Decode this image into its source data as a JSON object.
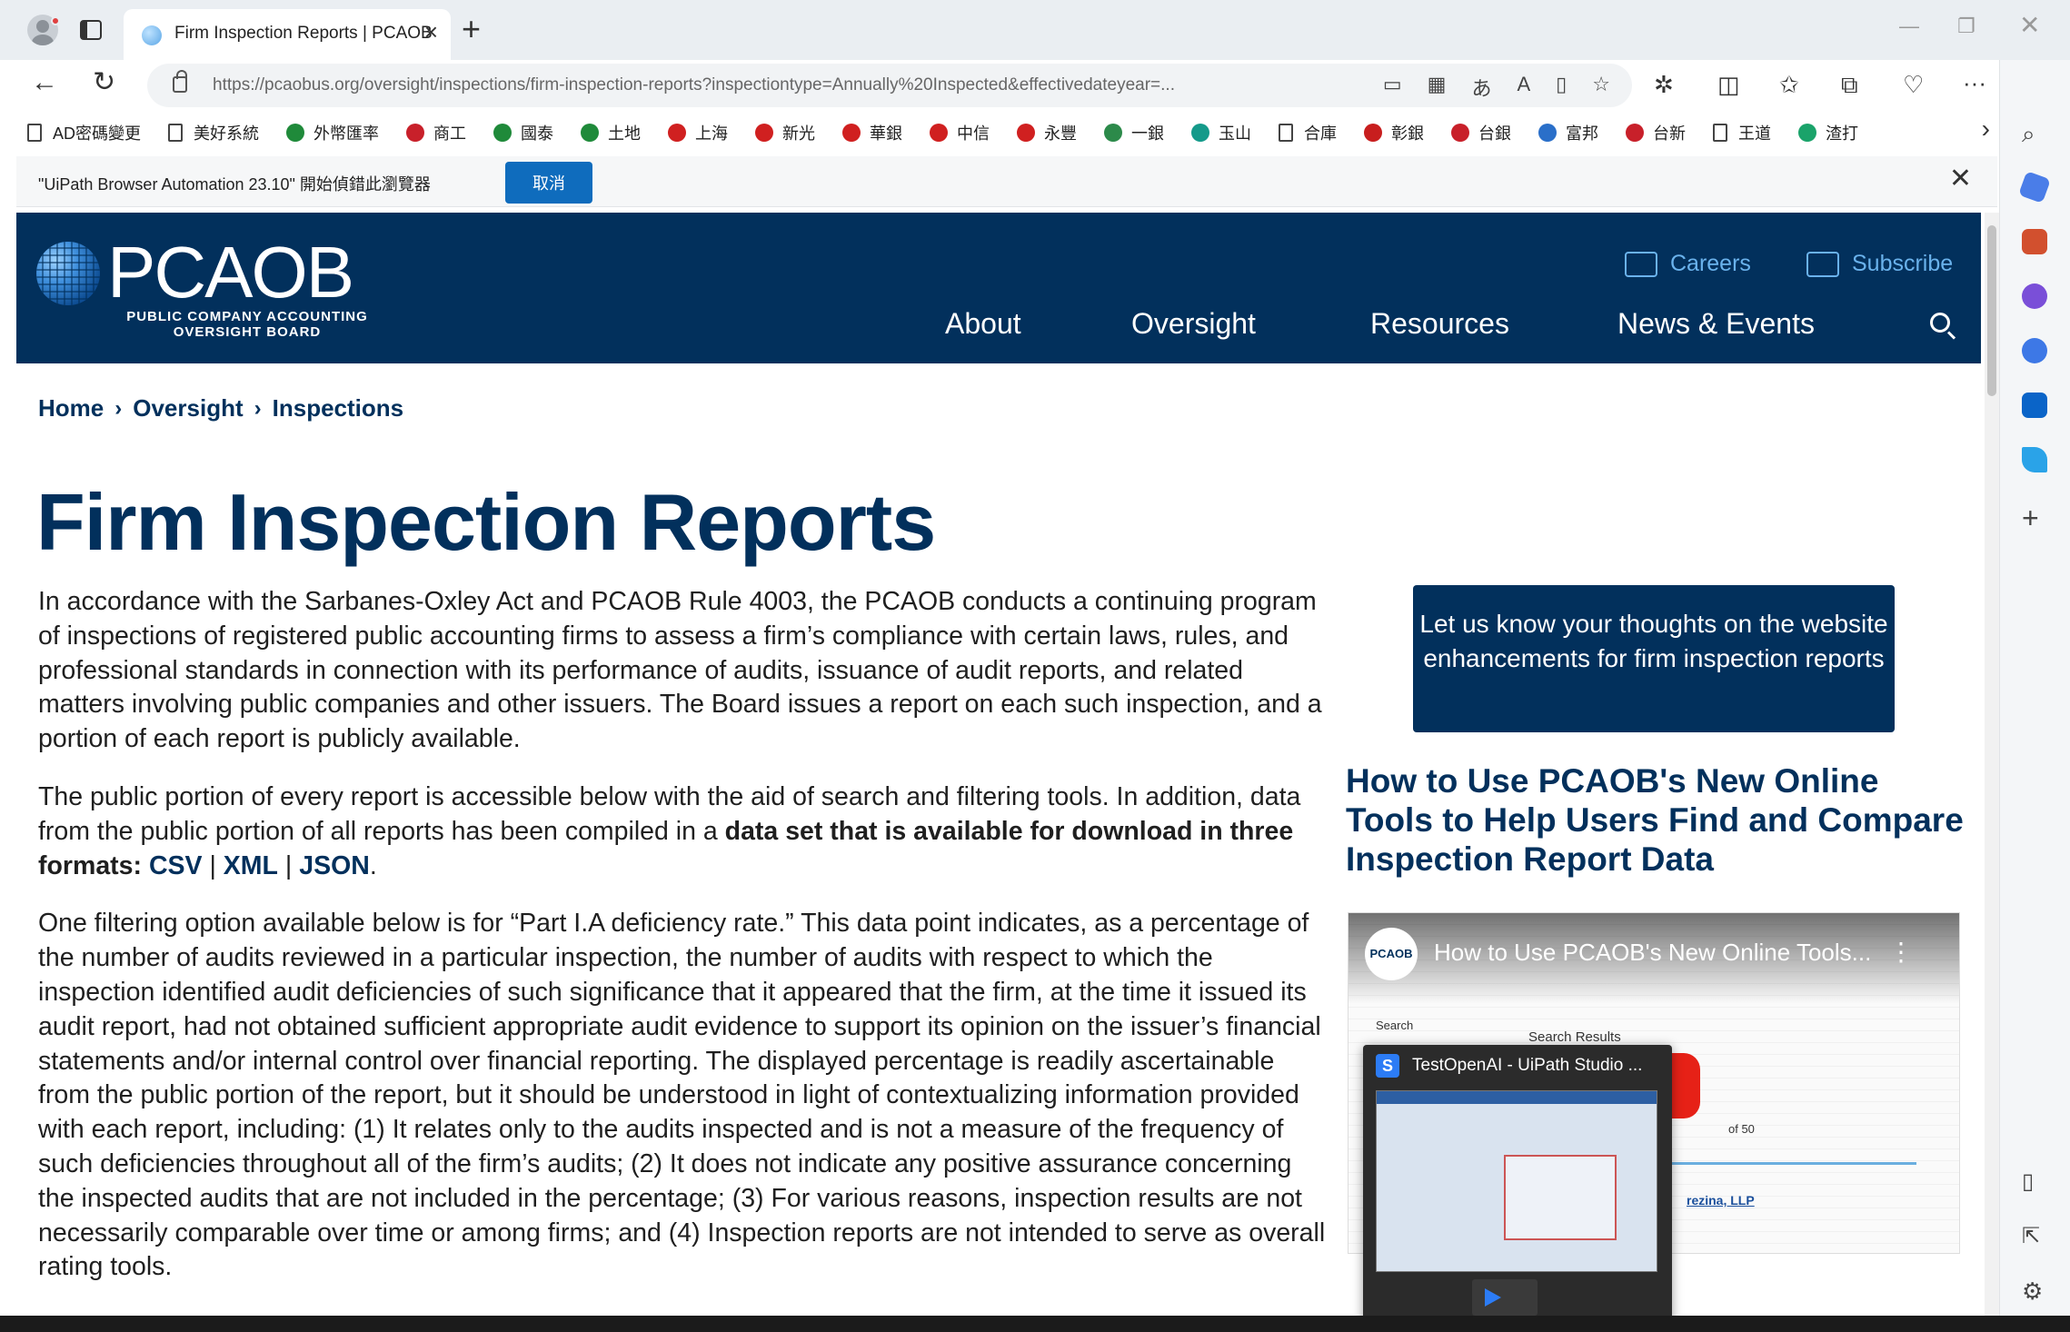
{
  "browser": {
    "tab_title": "Firm Inspection Reports | PCAOB",
    "url": "https://pcaobus.org/oversight/inspections/firm-inspection-reports?inspectiontype=Annually%20Inspected&effectivedateyear=...",
    "bookmarks": [
      "AD密碼變更",
      "美好系統",
      "外幣匯率",
      "商工",
      "國泰",
      "土地",
      "上海",
      "新光",
      "華銀",
      "中信",
      "永豐",
      "一銀",
      "玉山",
      "合庫",
      "彰銀",
      "台銀",
      "富邦",
      "台新",
      "王道",
      "渣打"
    ],
    "infobar_text": "\"UiPath Browser Automation 23.10\" 開始偵錯此瀏覽器",
    "infobar_cancel": "取消",
    "colors": {
      "accent": "#0f6cbd"
    }
  },
  "site": {
    "logo": "PCAOB",
    "logo_sub_1": "PUBLIC COMPANY ACCOUNTING",
    "logo_sub_2": "OVERSIGHT BOARD",
    "careers": "Careers",
    "subscribe": "Subscribe",
    "nav": [
      "About",
      "Oversight",
      "Resources",
      "News & Events"
    ],
    "colors": {
      "brand_navy": "#02305c",
      "link_blue": "#6ab2ec"
    }
  },
  "breadcrumb": [
    "Home",
    "Oversight",
    "Inspections"
  ],
  "page": {
    "title": "Firm Inspection Reports",
    "para1": "In accordance with the Sarbanes-Oxley Act and PCAOB Rule 4003, the PCAOB conducts a continuing program of inspections of registered public accounting firms to assess a firm’s compliance with certain laws, rules, and professional standards in connection with its performance of audits, issuance of audit reports, and related matters involving public companies and other issuers. The Board issues a report on each such inspection, and a portion of each report is publicly available.",
    "para2_start": "The public portion of every report is accessible below with the aid of search and filtering tools. In addition, data from the public portion of all reports has been compiled in a ",
    "para2_bold": "data set that is available for download in three formats: ",
    "link_csv": "CSV",
    "sep": " | ",
    "link_xml": "XML",
    "link_json": "JSON",
    "para2_end": ".",
    "para3": "One filtering option available below is for “Part I.A deficiency rate.” This data point indicates, as a percentage of the number of audits reviewed in a particular inspection, the number of audits with respect to which the inspection identified audit deficiencies of such significance that it appeared that the firm, at the time it issued its audit report, had not obtained sufficient appropriate audit evidence to support its opinion on the issuer’s financial statements and/or internal control over financial reporting. The displayed percentage is readily ascertainable from the public portion of the report, but it should be understood in light of contextualizing information provided with each report, including: (1) It relates only to the audits inspected and is not a measure of the frequency of such deficiencies throughout all of the firm’s audits; (2) It does not indicate any positive assurance concerning the inspected audits that are not included in the percentage; (3) For various reasons, inspection results are not necessarily comparable over time or among firms; and (4) Inspection reports are not intended to serve as overall rating tools."
  },
  "sidebar": {
    "feedback": "Let us know your thoughts on the website enhancements for firm inspection reports",
    "howto_title": "How to Use PCAOB's New Online Tools to Help Users Find and Compare Inspection Report Data",
    "video_channel": "PCAOB",
    "video_title": "How to Use PCAOB's New Online Tools...",
    "video_search": "Search",
    "video_results": "Search Results",
    "video_pager": "of 50",
    "video_firm": "rezina, LLP"
  },
  "popup": {
    "title": "TestOpenAI - UiPath Studio ..."
  }
}
